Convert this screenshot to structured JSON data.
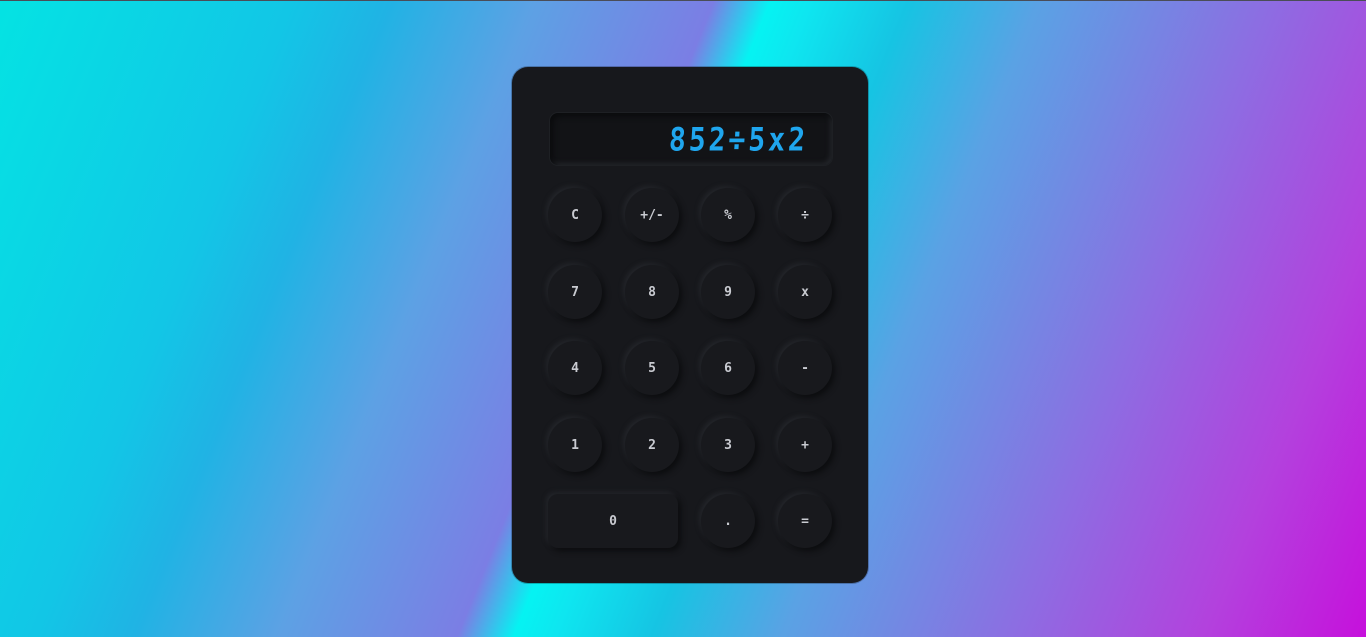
{
  "display": {
    "value": "852÷5x2"
  },
  "keys": {
    "clear": "C",
    "sign": "+/-",
    "percent": "%",
    "divide": "÷",
    "seven": "7",
    "eight": "8",
    "nine": "9",
    "multiply": "x",
    "four": "4",
    "five": "5",
    "six": "6",
    "subtract": "-",
    "one": "1",
    "two": "2",
    "three": "3",
    "add": "+",
    "zero": "0",
    "decimal": ".",
    "equals": "="
  },
  "colors": {
    "display_text": "#1fa6ee",
    "body": "#17181c",
    "key_text": "#c9cbd1"
  }
}
